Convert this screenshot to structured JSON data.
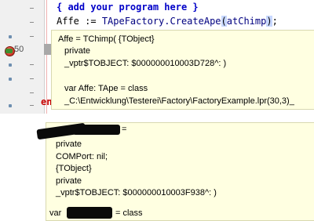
{
  "editor": {
    "code_lines": [
      "{ add your program here }",
      "Affe := TApeFactory.CreateApe(atChimp);"
    ],
    "line2_parts": {
      "ident": "Affe",
      "assign": " := ",
      "call": "TApeFactory.CreateApe",
      "open_paren": "(",
      "arg": "atChimp",
      "close_paren": ")",
      "semi": ";"
    },
    "end_keyword": "en",
    "gutter_line_number": "50"
  },
  "hint_top": {
    "lines": [
      "Affe = TChimp( {TObject}",
      "private",
      "_vptr$TOBJECT: $000000010003D728^: )",
      "var Affe: TApe = class",
      "_C:\\Entwicklung\\Testerei\\Factory\\FactoryExample.lpr(30,3)_"
    ]
  },
  "hint_bottom": {
    "lines": [
      "private",
      "COMPort: nil;",
      "{TObject}",
      "private",
      "_vptr$TOBJECT: $000000010003F938^: )",
      "var",
      "= class"
    ],
    "first_line_suffix": "="
  }
}
